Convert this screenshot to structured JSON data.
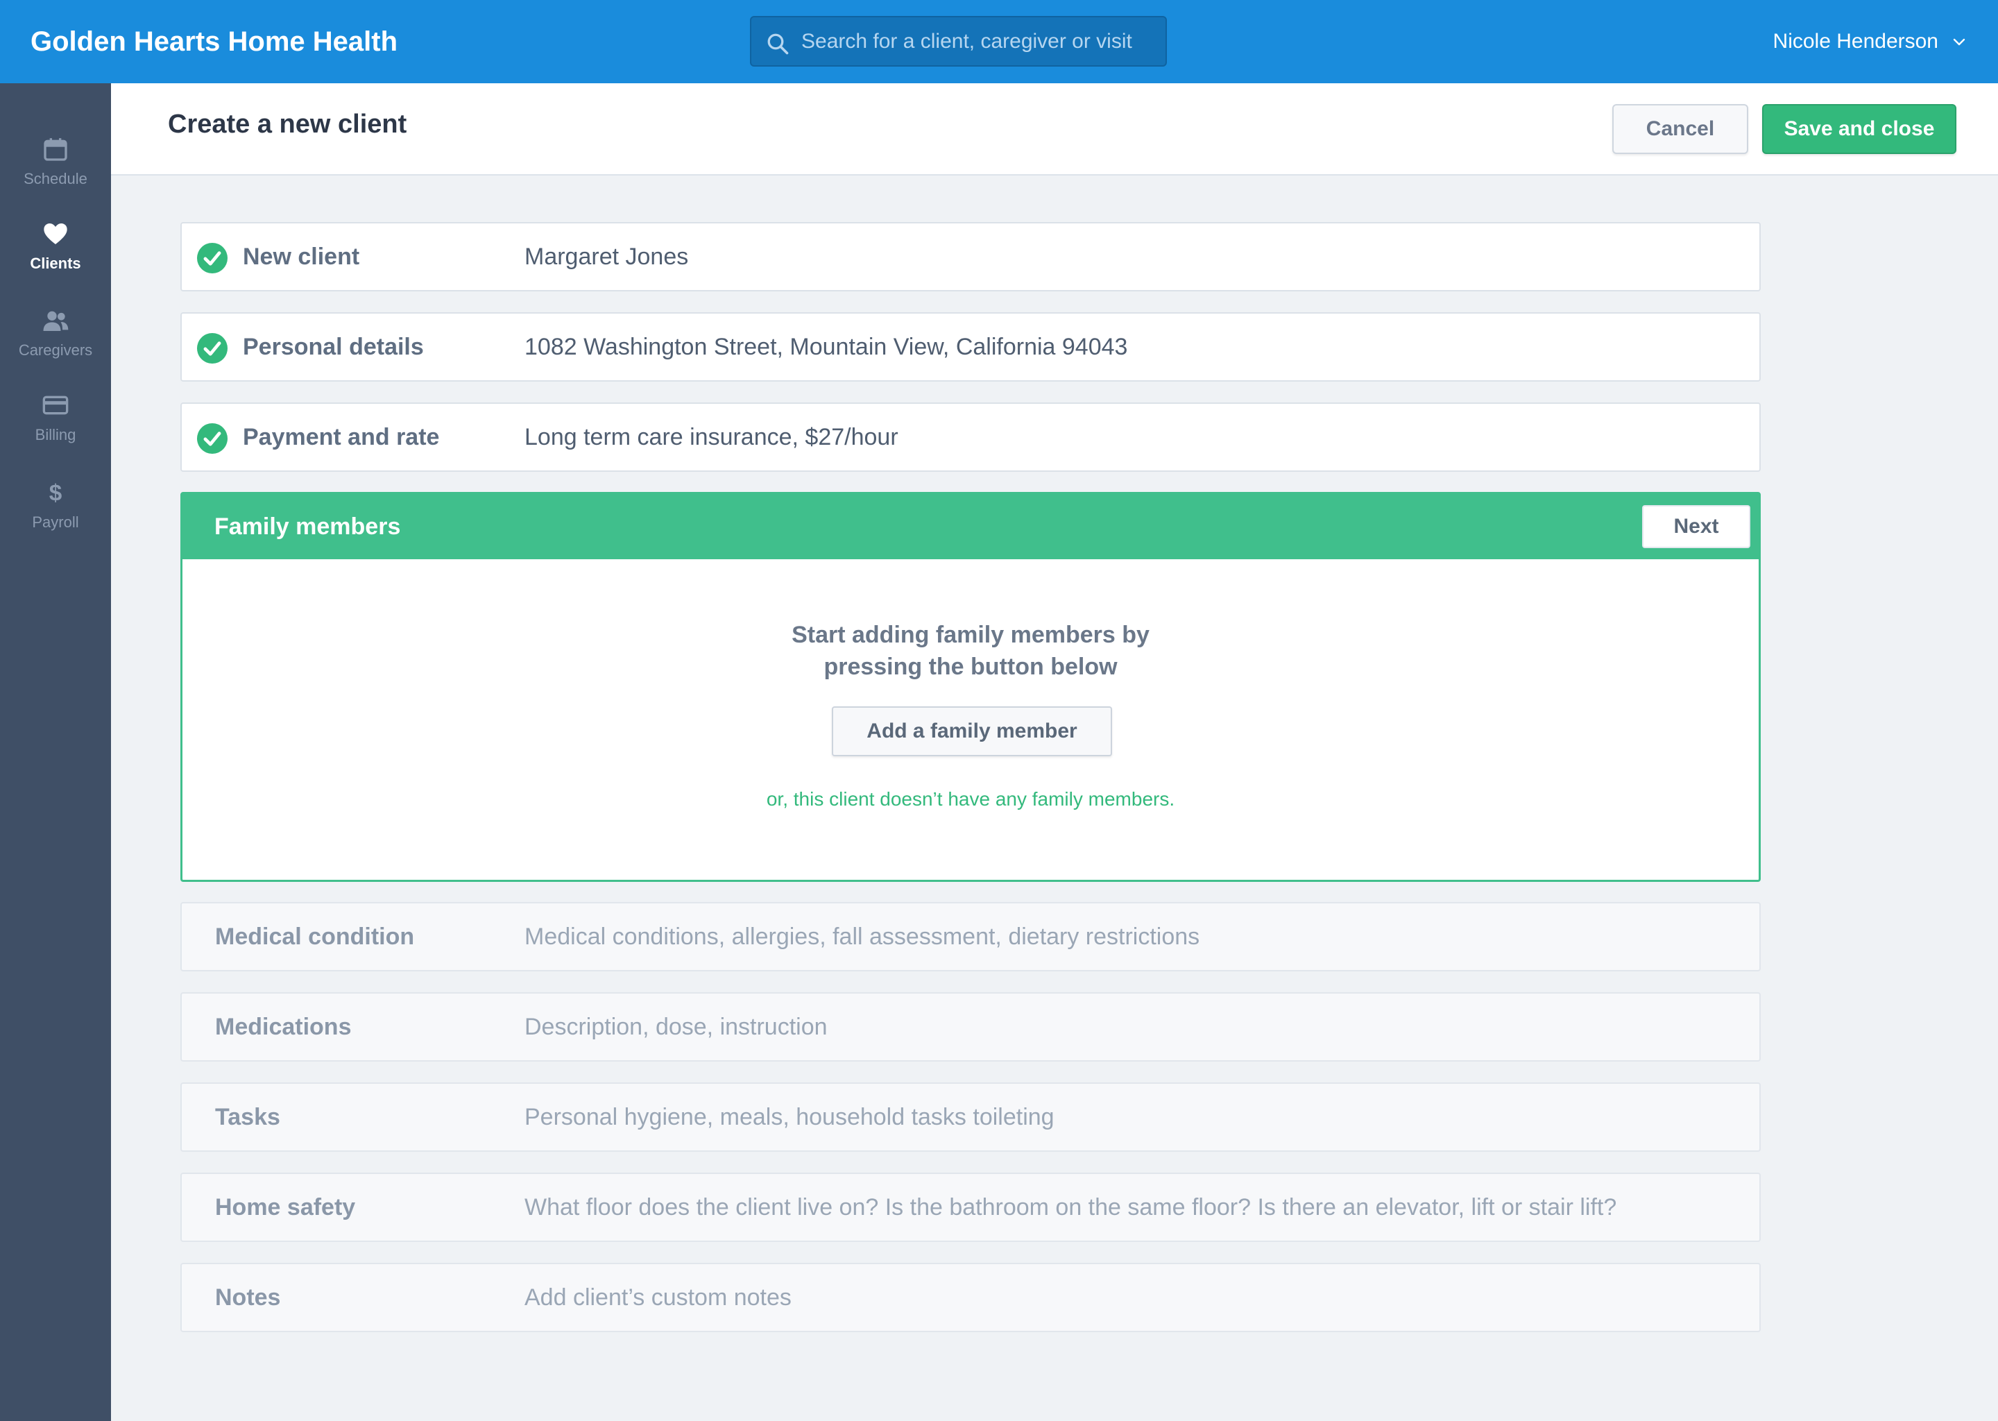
{
  "app": {
    "brand": "Golden Hearts Home Health",
    "search_placeholder": "Search for a client, caregiver or visit",
    "user_name": "Nicole Henderson"
  },
  "sidebar": {
    "items": [
      {
        "label": "Schedule",
        "icon": "calendar-icon",
        "active": false
      },
      {
        "label": "Clients",
        "icon": "heart-icon",
        "active": true
      },
      {
        "label": "Caregivers",
        "icon": "users-icon",
        "active": false
      },
      {
        "label": "Billing",
        "icon": "credit-card-icon",
        "active": false
      },
      {
        "label": "Payroll",
        "icon": "dollar-icon",
        "active": false
      }
    ]
  },
  "header": {
    "title": "Create a new client",
    "cancel_label": "Cancel",
    "save_label": "Save and close"
  },
  "completed_steps": [
    {
      "label": "New client",
      "value": "Margaret Jones"
    },
    {
      "label": "Personal details",
      "value": "1082 Washington Street, Mountain View, California 94043"
    },
    {
      "label": "Payment and rate",
      "value": "Long term care insurance, $27/hour"
    }
  ],
  "active_step": {
    "title": "Family members",
    "next_label": "Next",
    "empty_line1": "Start adding family members by",
    "empty_line2": "pressing the button below",
    "add_label": "Add a family member",
    "none_link": "or, this client doesn’t have any family members."
  },
  "pending_steps": [
    {
      "label": "Medical condition",
      "hint": "Medical conditions, allergies, fall assessment, dietary restrictions"
    },
    {
      "label": "Medications",
      "hint": "Description, dose, instruction"
    },
    {
      "label": "Tasks",
      "hint": "Personal hygiene, meals, household tasks toileting"
    },
    {
      "label": "Home safety",
      "hint": "What floor does the client live on? Is the bathroom on the same floor? Is there an elevator, lift or stair lift?"
    },
    {
      "label": "Notes",
      "hint": "Add client’s custom notes"
    }
  ],
  "colors": {
    "topbar": "#1a8cdc",
    "sidebar": "#3f4f66",
    "accent_green": "#40bf8c",
    "save_green": "#33b97c"
  }
}
